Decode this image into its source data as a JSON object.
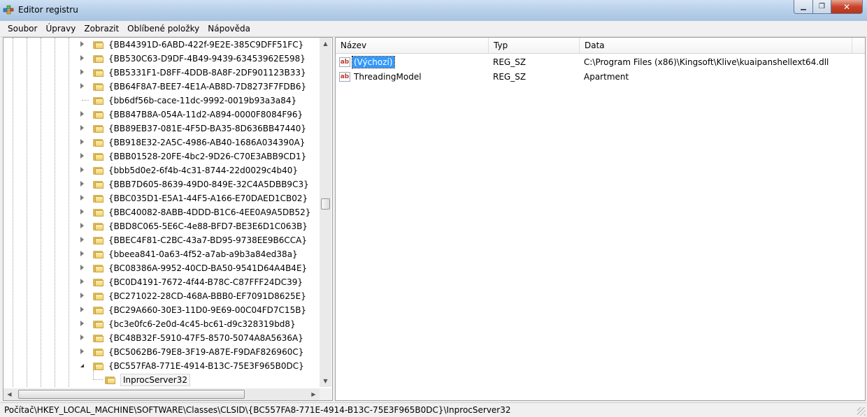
{
  "window": {
    "title": "Editor registru",
    "minimize_glyph": "▁",
    "maximize_glyph": "❐",
    "close_glyph": "✕"
  },
  "menu": [
    "Soubor",
    "Úpravy",
    "Zobrazit",
    "Oblíbené položky",
    "Nápověda"
  ],
  "tree": {
    "nodes": [
      {
        "label": "{BB44391D-6ABD-422f-9E2E-385C9DFF51FC}",
        "expander": "collapsed"
      },
      {
        "label": "{BB530C63-D9DF-4B49-9439-63453962E598}",
        "expander": "collapsed"
      },
      {
        "label": "{BB5331F1-D8FF-4DDB-8A8F-2DF901123B33}",
        "expander": "collapsed"
      },
      {
        "label": "{BB64F8A7-BEE7-4E1A-AB8D-7D8273F7FDB6}",
        "expander": "collapsed"
      },
      {
        "label": "{bb6df56b-cace-11dc-9992-0019b93a3a84}",
        "expander": "none"
      },
      {
        "label": "{BB847B8A-054A-11d2-A894-0000F8084F96}",
        "expander": "collapsed"
      },
      {
        "label": "{BB89EB37-081E-4F5D-BA35-8D636BB47440}",
        "expander": "collapsed"
      },
      {
        "label": "{BB918E32-2A5C-4986-AB40-1686A034390A}",
        "expander": "collapsed"
      },
      {
        "label": "{BBB01528-20FE-4bc2-9D26-C70E3ABB9CD1}",
        "expander": "collapsed"
      },
      {
        "label": "{bbb5d0e2-6f4b-4c31-8744-22d0029c4b40}",
        "expander": "collapsed"
      },
      {
        "label": "{BBB7D605-8639-49D0-849E-32C4A5DBB9C3}",
        "expander": "collapsed"
      },
      {
        "label": "{BBC035D1-E5A1-44F5-A166-E70DAED1CB02}",
        "expander": "collapsed"
      },
      {
        "label": "{BBC40082-8ABB-4DDD-B1C6-4EE0A9A5DB52}",
        "expander": "collapsed"
      },
      {
        "label": "{BBD8C065-5E6C-4e88-BFD7-BE3E6D1C063B}",
        "expander": "collapsed"
      },
      {
        "label": "{BBEC4F81-C2BC-43a7-BD95-9738EE9B6CCA}",
        "expander": "collapsed"
      },
      {
        "label": "{bbeea841-0a63-4f52-a7ab-a9b3a84ed38a}",
        "expander": "collapsed"
      },
      {
        "label": "{BC08386A-9952-40CD-BA50-9541D64A4B4E}",
        "expander": "collapsed"
      },
      {
        "label": "{BC0D4191-7672-4f44-B78C-C87FFF24DC39}",
        "expander": "collapsed"
      },
      {
        "label": "{BC271022-28CD-468A-BBB0-EF7091D8625E}",
        "expander": "collapsed"
      },
      {
        "label": "{BC29A660-30E3-11D0-9E69-00C04FD7C15B}",
        "expander": "collapsed"
      },
      {
        "label": "{bc3e0fc6-2e0d-4c45-bc61-d9c328319bd8}",
        "expander": "collapsed"
      },
      {
        "label": "{BC48B32F-5910-47F5-8570-5074A8A5636A}",
        "expander": "collapsed"
      },
      {
        "label": "{BC5062B6-79E8-3F19-A87E-F9DAF826960C}",
        "expander": "collapsed"
      },
      {
        "label": "{BC557FA8-771E-4914-B13C-75E3F965B0DC}",
        "expander": "expanded"
      },
      {
        "label": "InprocServer32",
        "expander": "child"
      }
    ]
  },
  "list": {
    "columns": [
      "Název",
      "Typ",
      "Data"
    ],
    "rows": [
      {
        "name": "(Výchozí)",
        "type": "REG_SZ",
        "data": "C:\\Program Files (x86)\\Kingsoft\\Klive\\kuaipanshellext64.dll",
        "selected": true
      },
      {
        "name": "ThreadingModel",
        "type": "REG_SZ",
        "data": "Apartment",
        "selected": false
      }
    ],
    "value_icon_text": "ab"
  },
  "status": {
    "path": "Počítač\\HKEY_LOCAL_MACHINE\\SOFTWARE\\Classes\\CLSID\\{BC557FA8-771E-4914-B13C-75E3F965B0DC}\\InprocServer32"
  },
  "colors": {
    "selection": "#3399ff",
    "folder": "#f2cf6b"
  }
}
